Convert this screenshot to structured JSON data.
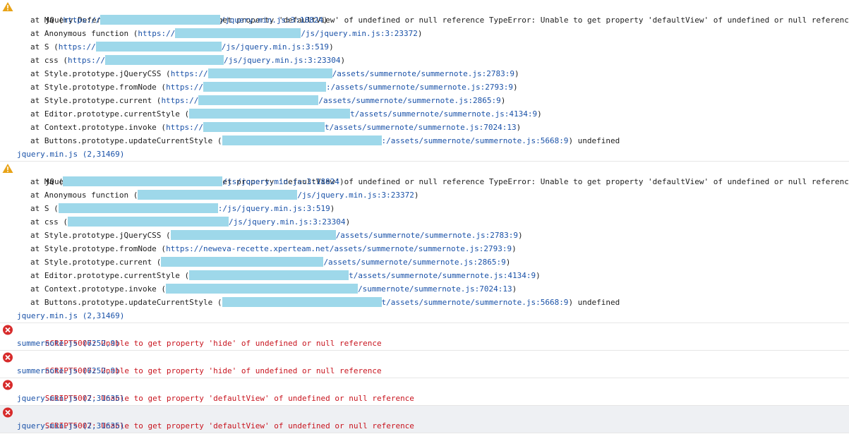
{
  "console": {
    "warnings": [
      {
        "type": "warning",
        "message": "jQuery.Deferred exception: Unable to get property 'defaultView' of undefined or null reference TypeError: Unable to get property 'defaultView' of undefined or null reference",
        "stack": [
          {
            "fn": "at Ma (",
            "pre": "https://",
            "post": "/jquery.min.js:3:18824",
            "close": ")"
          },
          {
            "fn": "at Anonymous function (",
            "pre": "https://",
            "post": "/js/jquery.min.js:3:23372",
            "close": ")"
          },
          {
            "fn": "at S (",
            "pre": "https://",
            "post": "/js/jquery.min.js:3:519",
            "close": ")"
          },
          {
            "fn": "at css (",
            "pre": "https://",
            "post": "/js/jquery.min.js:3:23304",
            "close": ")"
          },
          {
            "fn": "at Style.prototype.jQueryCSS (",
            "pre": "https://",
            "post": "/assets/summernote/summernote.js:2783:9",
            "close": ")"
          },
          {
            "fn": "at Style.prototype.fromNode (",
            "pre": "https://",
            "post": ":/assets/summernote/summernote.js:2793:9",
            "close": ")"
          },
          {
            "fn": "at Style.prototype.current (",
            "pre": "https://",
            "post": "/assets/summernote/summernote.js:2865:9",
            "close": ")"
          },
          {
            "fn": "at Editor.prototype.currentStyle (",
            "pre": "",
            "post": "t/assets/summernote/summernote.js:4134:9",
            "close": ")"
          },
          {
            "fn": "at Context.prototype.invoke (",
            "pre": "https://",
            "post": "t/assets/summernote/summernote.js:7024:13",
            "close": ")"
          },
          {
            "fn": "at Buttons.prototype.updateCurrentStyle (",
            "pre": "",
            "post": ":/assets/summernote/summernote.js:5668:9",
            "close": ") undefined"
          }
        ],
        "source": "jquery.min.js (2,31469)"
      },
      {
        "type": "warning",
        "message": "jQuery.Deferred exception: Unable to get property 'defaultView' of undefined or null reference TypeError: Unable to get property 'defaultView' of undefined or null reference",
        "stack": [
          {
            "fn": "at Ma (",
            "pre": "",
            "post": "/js/jquery.min.js:3:18824",
            "close": ")"
          },
          {
            "fn": "at Anonymous function (",
            "pre": "",
            "post": "/js/jquery.min.js:3:23372",
            "close": ")"
          },
          {
            "fn": "at S (",
            "pre": "",
            "post": ":/js/jquery.min.js:3:519",
            "close": ")"
          },
          {
            "fn": "at css (",
            "pre": "",
            "post": "/js/jquery.min.js:3:23304",
            "close": ")"
          },
          {
            "fn": "at Style.prototype.jQueryCSS (",
            "pre": "",
            "post": "/assets/summernote/summernote.js:2783:9",
            "close": ")"
          },
          {
            "fn": "at Style.prototype.fromNode (",
            "pre": "https://neweva-recette.xperteam.net",
            "post": "/assets/summernote/summernote.js:2793:9",
            "close": ")"
          },
          {
            "fn": "at Style.prototype.current (",
            "pre": "",
            "post": "/assets/summernote/summernote.js:2865:9",
            "close": ")"
          },
          {
            "fn": "at Editor.prototype.currentStyle (",
            "pre": "",
            "post": "t/assets/summernote/summernote.js:4134:9",
            "close": ")"
          },
          {
            "fn": "at Context.prototype.invoke (",
            "pre": "",
            "post": "/summernote/summernote.js:7024:13",
            "close": ")"
          },
          {
            "fn": "at Buttons.prototype.updateCurrentStyle (",
            "pre": "",
            "post": "t/assets/summernote/summernote.js:5668:9",
            "close": ") undefined"
          }
        ],
        "source": "jquery.min.js (2,31469)"
      }
    ],
    "errors": [
      {
        "type": "error",
        "message": "SCRIPT5007: Unable to get property 'hide' of undefined or null reference",
        "source": "summernote.js (6252,9)"
      },
      {
        "type": "error",
        "message": "SCRIPT5007: Unable to get property 'hide' of undefined or null reference",
        "source": "summernote.js (6252,9)"
      },
      {
        "type": "error",
        "message": "SCRIPT5007: Unable to get property 'defaultView' of undefined or null reference",
        "source": "jquery.min.js (2,31635)"
      },
      {
        "type": "error",
        "message": "SCRIPT5007: Unable to get property 'defaultView' of undefined or null reference",
        "source": "jquery.min.js (2,31635)"
      }
    ],
    "colors": {
      "link": "#1a52a8",
      "error_text": "#c8141e",
      "warning_icon": "#e8a317",
      "error_icon": "#d72b2b",
      "redaction": "#9ed8ea"
    }
  }
}
